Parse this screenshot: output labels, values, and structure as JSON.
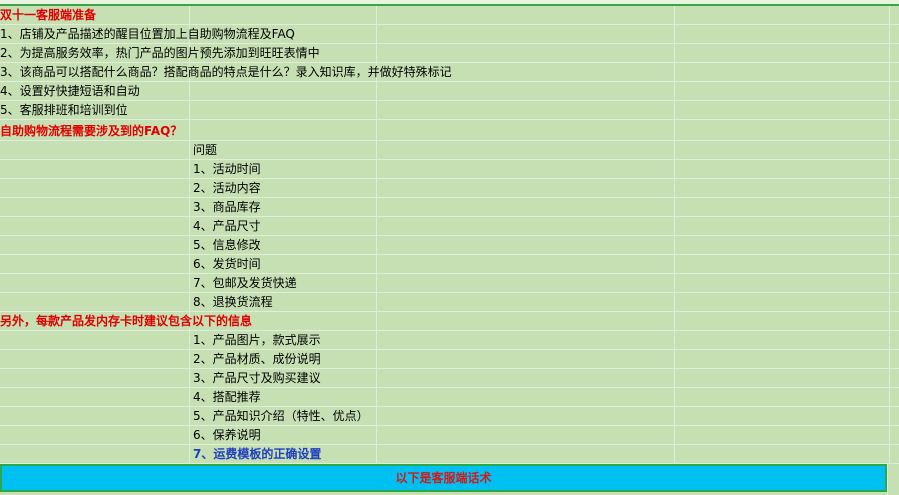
{
  "section1": {
    "title": "双十一客服端准备",
    "items": [
      "1、店铺及产品描述的醒目位置加上自助购物流程及FAQ",
      "2、为提高服务效率，热门产品的图片预先添加到旺旺表情中",
      "3、该商品可以搭配什么商品？搭配商品的特点是什么？录入知识库，并做好特殊标记",
      "4、设置好快捷短语和自动",
      "5、客服排班和培训到位"
    ]
  },
  "section2": {
    "title": "自助购物流程需要涉及到的FAQ？",
    "header": "问题",
    "items": [
      "1、活动时间",
      "2、活动内容",
      "3、商品库存",
      "4、产品尺寸",
      "5、信息修改",
      "6、发货时间",
      "7、包邮及发货快递",
      "8、退换货流程"
    ]
  },
  "section3": {
    "title": "另外，每款产品发内存卡时建议包含以下的信息",
    "items": [
      "1、产品图片，款式展示",
      "2、产品材质、成份说明",
      "3、产品尺寸及购买建议",
      "4、搭配推荐",
      "5、产品知识介绍（特性、优点）",
      "6、保养说明",
      "7、运费模板的正确设置"
    ]
  },
  "banner": {
    "text": "以下是客服端话术"
  },
  "colors": {
    "cell_bg": "#c6e0b4",
    "banner_bg": "#00c0f2",
    "title_red": "#e00000",
    "link_blue": "#1f3fbf"
  }
}
